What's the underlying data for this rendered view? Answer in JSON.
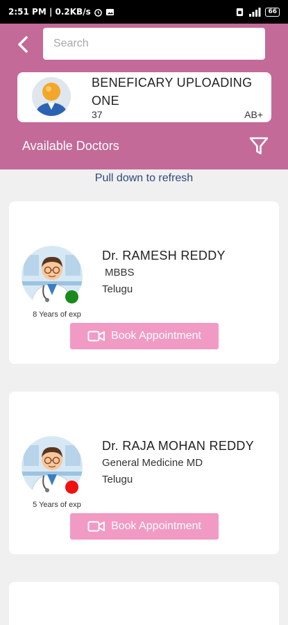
{
  "statusbar": {
    "time_info": "2:51 PM | 0.2KB/s",
    "battery": "66"
  },
  "header": {
    "search_placeholder": "Search",
    "beneficiary": {
      "name": "BENEFICARY UPLOADING ONE",
      "age": "37",
      "blood_group": "AB+"
    },
    "section_title": "Available Doctors"
  },
  "refresh_hint": "Pull down to refresh",
  "doctors": [
    {
      "name": "Dr. RAMESH REDDY",
      "degree": "MBBS",
      "language": "Telugu",
      "experience": "8 Years of exp",
      "status": "online",
      "status_color": "#1a8a1a",
      "book_label": "Book Appointment"
    },
    {
      "name": "Dr. RAJA MOHAN REDDY",
      "degree": "General Medicine MD",
      "language": "Telugu",
      "experience": "5 Years of exp",
      "status": "offline",
      "status_color": "#ee1111",
      "book_label": "Book Appointment"
    }
  ],
  "colors": {
    "header": "#c36a98",
    "button": "#f19ac4",
    "accent_text": "#2d4a7a"
  }
}
